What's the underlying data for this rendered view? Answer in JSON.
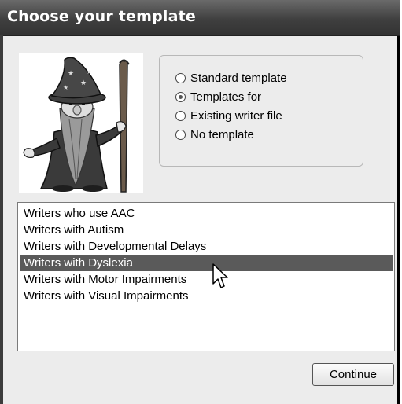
{
  "window": {
    "title": "Choose your template"
  },
  "template_options": [
    {
      "label": "Standard template",
      "checked": false
    },
    {
      "label": "Templates for",
      "checked": true
    },
    {
      "label": "Existing writer file",
      "checked": false
    },
    {
      "label": "No template",
      "checked": false
    }
  ],
  "writers_list": {
    "items": [
      "Writers who use AAC",
      "Writers with Autism",
      "Writers with Developmental Delays",
      "Writers with Dyslexia",
      "Writers with Motor Impairments",
      "Writers with Visual Impairments"
    ],
    "selected": "Writers with Dyslexia"
  },
  "buttons": {
    "continue": "Continue"
  },
  "icons": {
    "mascot": "wizard-icon",
    "pointer": "mouse-pointer-icon"
  }
}
